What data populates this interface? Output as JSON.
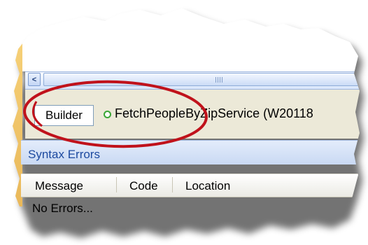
{
  "scroll": {
    "left_arrow": "<"
  },
  "tab": {
    "builder_label": "Builder"
  },
  "service": {
    "label": "FetchPeopleByZipService (W20118"
  },
  "syntax_errors": {
    "title": "Syntax Errors",
    "columns": [
      "Message",
      "Code",
      "Location"
    ],
    "empty_text": "No Errors..."
  },
  "colors": {
    "annotation_ellipse": "#c0121b",
    "status_dot": "#3aa635",
    "panel_title": "#1d4aa0"
  }
}
